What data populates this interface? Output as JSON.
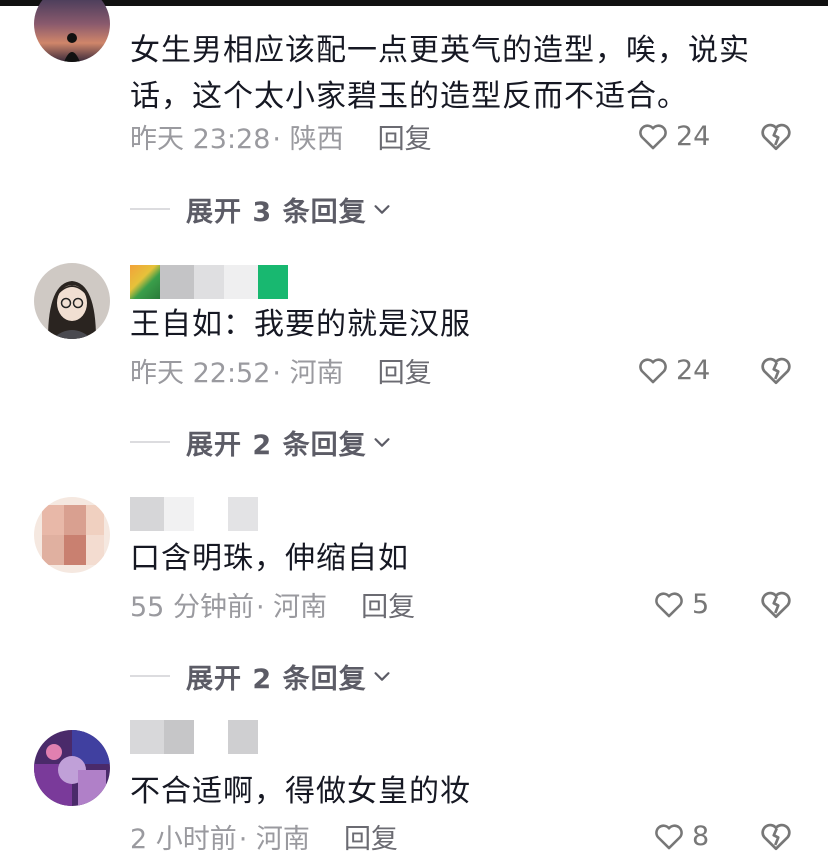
{
  "comments": [
    {
      "text": "女生男相应该配一点更英气的造型，唉，说实话，这个太小家碧玉的造型反而不适合。",
      "time": "昨天 23:28",
      "location": "· 陕西",
      "reply": "回复",
      "likes": "24",
      "expand": "展开 3 条回复"
    },
    {
      "text": "王自如：我要的就是汉服",
      "time": "昨天 22:52",
      "location": "· 河南",
      "reply": "回复",
      "likes": "24",
      "expand": "展开 2 条回复"
    },
    {
      "text": "口含明珠，伸缩自如",
      "time": "55 分钟前",
      "location": "· 河南",
      "reply": "回复",
      "likes": "5",
      "expand": "展开 2 条回复"
    },
    {
      "text": "不合适啊，得做女皇的妆",
      "time": "2 小时前",
      "location": "· 河南",
      "reply": "回复",
      "likes": "8"
    }
  ],
  "icons": {
    "like": "heart-outline-icon",
    "dislike": "broken-heart-icon",
    "expand": "chevron-down-icon"
  },
  "colors": {
    "text": "#161823",
    "meta": "#9a9a9f",
    "expand": "#5c5c66"
  }
}
